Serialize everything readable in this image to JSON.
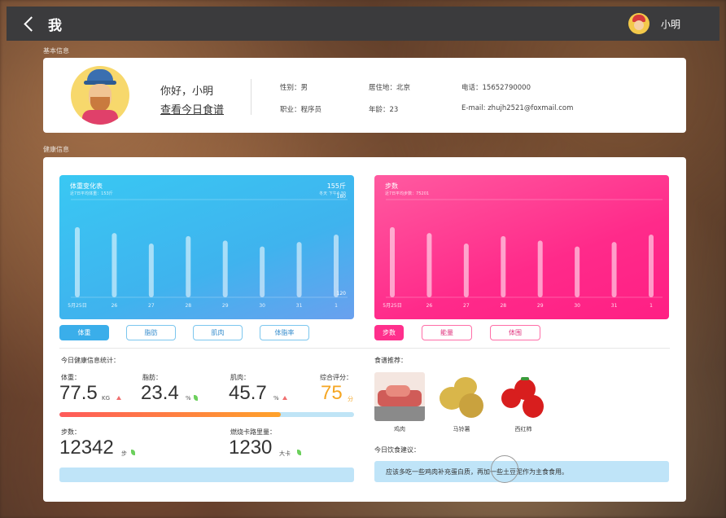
{
  "topbar": {
    "title": "我",
    "username": "小明"
  },
  "sections": {
    "basic": "基本信息",
    "health": "健康信息"
  },
  "profile": {
    "greeting": "你好，小明",
    "today_link": "查看今日食谱",
    "gender": "性别：男",
    "job": "职业：程序员",
    "residence": "居住地：北京",
    "age": "年龄：23",
    "phone": "电话：15652790000",
    "email": "E-mail: zhujh2521@foxmail.com"
  },
  "weight_chart": {
    "title": "体重变化表",
    "subtitle": "近7日平均体重：153斤",
    "value": "155斤",
    "value_sub": "冬天 下午4:30",
    "ymax": "180",
    "ymin": "120",
    "x_labels": [
      "5月25日",
      "26",
      "27",
      "28",
      "29",
      "30",
      "31",
      "1"
    ]
  },
  "steps_chart": {
    "title": "步数",
    "subtitle": "近7日平均步数：75201",
    "x_labels": [
      "5月25日",
      "26",
      "27",
      "28",
      "29",
      "30",
      "31",
      "1"
    ]
  },
  "chart_data": [
    {
      "type": "bar",
      "title": "体重变化表",
      "categories": [
        "5月25日",
        "26",
        "27",
        "28",
        "29",
        "30",
        "31",
        "1"
      ],
      "values": [
        167,
        163,
        156,
        161,
        158,
        154,
        157,
        162
      ],
      "ylim": [
        120,
        180
      ]
    },
    {
      "type": "bar",
      "title": "步数",
      "categories": [
        "5月25日",
        "26",
        "27",
        "28",
        "29",
        "30",
        "31",
        "1"
      ],
      "values": [
        167,
        163,
        156,
        161,
        158,
        154,
        157,
        162
      ],
      "ylim": [
        120,
        180
      ]
    }
  ],
  "left_tabs": [
    "体重",
    "脂肪",
    "肌肉",
    "体脂率"
  ],
  "right_tabs": [
    "步数",
    "能量",
    "体围"
  ],
  "stats": {
    "heading": "今日健康信息统计：",
    "weight_label": "体重：",
    "weight": "77.5",
    "weight_unit": "KG",
    "fat_label": "脂肪：",
    "fat": "23.4",
    "fat_unit": "%",
    "muscle_label": "肌肉：",
    "muscle": "45.7",
    "muscle_unit": "%",
    "score_label": "综合评分：",
    "score": "75",
    "score_unit": "分",
    "score_progress": 0.75,
    "steps_label": "步数：",
    "steps": "12342",
    "steps_unit": "步",
    "calorie_label": "燃烧卡路里量：",
    "calorie": "1230",
    "calorie_unit": "大卡"
  },
  "food": {
    "heading": "食谱推荐：",
    "items": [
      "鸡肉",
      "马铃薯",
      "西红柿"
    ],
    "advice_heading": "今日饮食建议：",
    "advice": "应该多吃一些鸡肉补充蛋白质，再加一些土豆泥作为主食食用。"
  },
  "colors": {
    "blue_accent": "#3aaeea",
    "pink_accent": "#ff2f8c",
    "score": "#f5a623"
  }
}
